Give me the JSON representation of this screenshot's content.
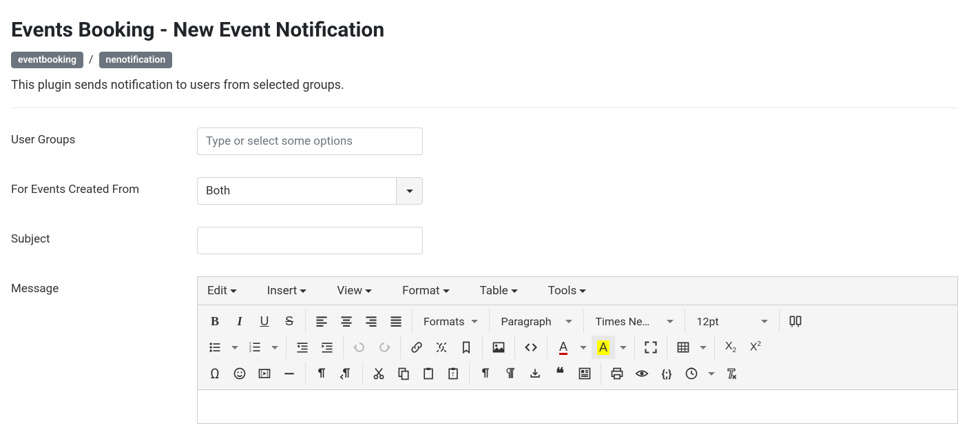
{
  "page": {
    "title": "Events Booking - New Event Notification",
    "breadcrumb": {
      "folder": "eventbooking",
      "element": "nenotification",
      "separator": "/"
    },
    "description": "This plugin sends notification to users from selected groups."
  },
  "form": {
    "userGroups": {
      "label": "User Groups",
      "placeholder": "Type or select some options",
      "value": ""
    },
    "eventsCreatedFrom": {
      "label": "For Events Created From",
      "value": "Both"
    },
    "subject": {
      "label": "Subject",
      "value": ""
    },
    "message": {
      "label": "Message"
    }
  },
  "editor": {
    "menus": {
      "edit": "Edit",
      "insert": "Insert",
      "view": "View",
      "format": "Format",
      "table": "Table",
      "tools": "Tools"
    },
    "dropdowns": {
      "formats": "Formats",
      "paragraph": "Paragraph",
      "font": "Times Ne…",
      "fontsize": "12pt"
    },
    "icons": {
      "bold": "B",
      "italic": "I",
      "underline": "U",
      "strike": "S",
      "textcolor": "A",
      "backcolor": "A",
      "subscript_base": "X",
      "subscript_sub": "2",
      "superscript_base": "X",
      "superscript_sup": "2",
      "specialchar": "Ω",
      "emoji": "☺",
      "blockquote_glyph": "❝",
      "codesample_glyph": "{;}"
    }
  }
}
